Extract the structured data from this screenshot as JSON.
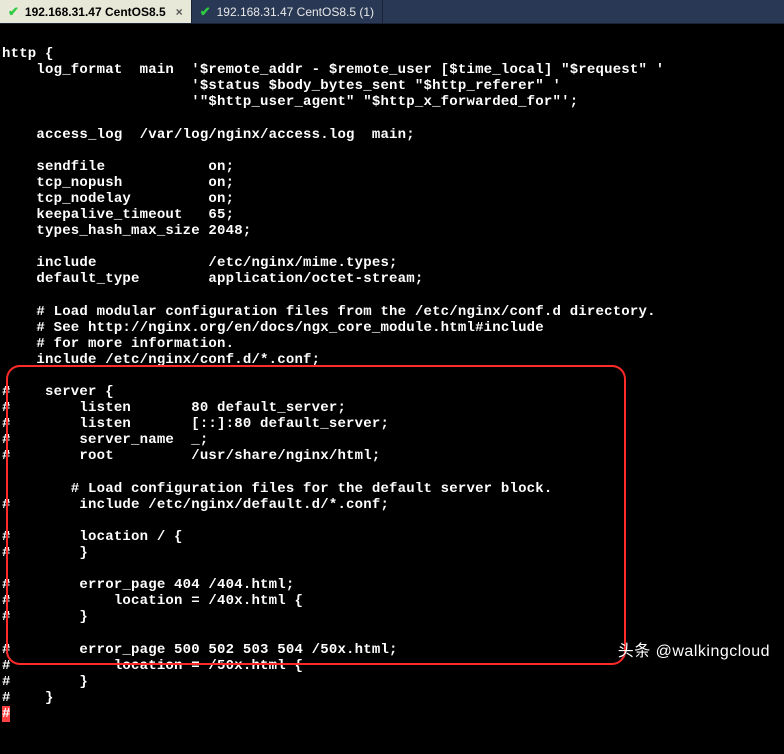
{
  "tabs": [
    {
      "label": "192.168.31.47 CentOS8.5",
      "active": true
    },
    {
      "label": "192.168.31.47 CentOS8.5 (1)",
      "active": false
    }
  ],
  "terminal_lines": [
    "",
    "http {",
    "    log_format  main  '$remote_addr - $remote_user [$time_local] \"$request\" '",
    "                      '$status $body_bytes_sent \"$http_referer\" '",
    "                      '\"$http_user_agent\" \"$http_x_forwarded_for\"';",
    "",
    "    access_log  /var/log/nginx/access.log  main;",
    "",
    "    sendfile            on;",
    "    tcp_nopush          on;",
    "    tcp_nodelay         on;",
    "    keepalive_timeout   65;",
    "    types_hash_max_size 2048;",
    "",
    "    include             /etc/nginx/mime.types;",
    "    default_type        application/octet-stream;",
    "",
    "    # Load modular configuration files from the /etc/nginx/conf.d directory.",
    "    # See http://nginx.org/en/docs/ngx_core_module.html#include",
    "    # for more information.",
    "    include /etc/nginx/conf.d/*.conf;",
    "",
    "#    server {",
    "#        listen       80 default_server;",
    "#        listen       [::]:80 default_server;",
    "#        server_name  _;",
    "#        root         /usr/share/nginx/html;",
    "",
    "        # Load configuration files for the default server block.",
    "#        include /etc/nginx/default.d/*.conf;",
    "",
    "#        location / {",
    "#        }",
    "",
    "#        error_page 404 /404.html;",
    "#            location = /40x.html {",
    "#        }",
    "",
    "#        error_page 500 502 503 504 /50x.html;",
    "#            location = /50x.html {",
    "#        }",
    "#    }"
  ],
  "cursor_line_prefix": "",
  "cursor_char": "#",
  "watermark": "头条 @walkingcloud"
}
